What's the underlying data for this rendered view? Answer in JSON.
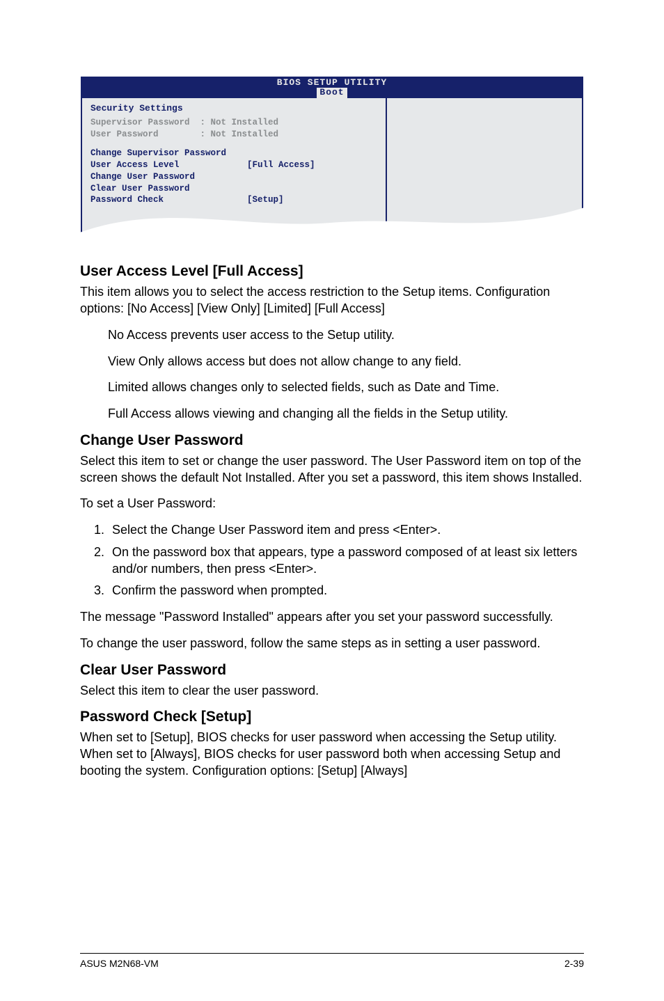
{
  "bios": {
    "title_top": "BIOS SETUP UTILITY",
    "title_bottom": "Boot",
    "panel_heading": "Security Settings",
    "rows": {
      "sup_pw": "Supervisor Password  : Not Installed",
      "user_pw": "User Password        : Not Installed",
      "chg_sup": "Change Supervisor Password",
      "ual": "User Access Level             [Full Access]",
      "chg_user": "Change User Password",
      "clr_user": "Clear User Password",
      "pw_check": "Password Check                [Setup]"
    }
  },
  "sections": {
    "ual_title": "User Access Level [Full Access]",
    "ual_p1": "This item allows you to select the access restriction to the Setup items. Configuration options: [No Access] [View Only] [Limited] [Full Access]",
    "ual_noaccess": "No Access prevents user access to the Setup utility.",
    "ual_viewonly": "View Only allows access but does not allow change to any field.",
    "ual_limited": "Limited allows changes only to selected fields, such as Date and Time.",
    "ual_full": "Full Access allows viewing and changing all the fields in the Setup utility.",
    "chg_user_title": "Change User Password",
    "chg_user_p1": "Select this item to set or change the user password. The User Password item on top of the screen shows the default Not Installed. After you set a password, this item shows Installed.",
    "chg_user_p2": "To set a User Password:",
    "steps": {
      "s1": "Select the Change User Password item and press <Enter>.",
      "s2": "On the password box that appears, type a password composed of at least six letters and/or numbers, then press <Enter>.",
      "s3": "Confirm the password when prompted."
    },
    "chg_user_p3": "The message \"Password Installed\" appears after you set your password successfully.",
    "chg_user_p4": "To change the user password, follow the same steps as in setting a user password.",
    "clr_title": "Clear User Password",
    "clr_p1": "Select this item to clear the user password.",
    "pwcheck_title": "Password Check [Setup]",
    "pwcheck_p1": "When set to [Setup], BIOS checks for user password when accessing the Setup utility. When set to [Always], BIOS checks for user password both when accessing Setup and booting the system. Configuration options: [Setup] [Always]"
  },
  "footer": {
    "left": "ASUS M2N68-VM",
    "right": "2-39"
  }
}
